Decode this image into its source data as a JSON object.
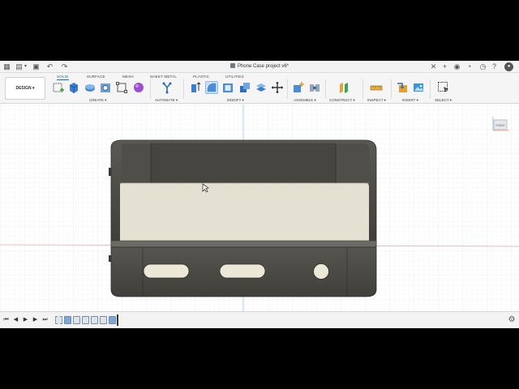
{
  "app": {
    "document_title": "Phone Case project v6*"
  },
  "toolbar": {
    "workspace_button": "DESIGN ▾",
    "tabs": [
      "SOLID",
      "SURFACE",
      "MESH",
      "SHEET METAL",
      "PLASTIC",
      "UTILITIES"
    ],
    "active_tab": "SOLID",
    "groups": [
      "CREATE ▾",
      "AUTOMATE ▾",
      "MODIFY ▾",
      "ASSEMBLE ▾",
      "CONSTRUCT ▾",
      "INSPECT ▾",
      "INSERT ▾",
      "SELECT ▾"
    ]
  },
  "viewcube": {
    "face_label": "FRONT"
  },
  "colors": {
    "accent": "#0b6fbf",
    "model_body": "#4a4944",
    "model_highlight": "#6b6a64",
    "model_inner": "#e6e2d3",
    "axis_red": "#e85a5a",
    "axis_blue": "#7aa0e8"
  },
  "icons": {
    "titlebar_left": [
      "grid-icon",
      "file-icon",
      "save-icon",
      "undo-icon",
      "redo-icon"
    ],
    "titlebar_right": [
      "close-icon",
      "add-tab-icon",
      "extensions-icon",
      "job-status-icon",
      "notifications-icon",
      "help-icon",
      "profile-icon"
    ],
    "timeline": [
      "skip-start-icon",
      "step-back-icon",
      "play-icon",
      "step-forward-icon",
      "skip-end-icon"
    ],
    "settings": "gear-icon"
  }
}
